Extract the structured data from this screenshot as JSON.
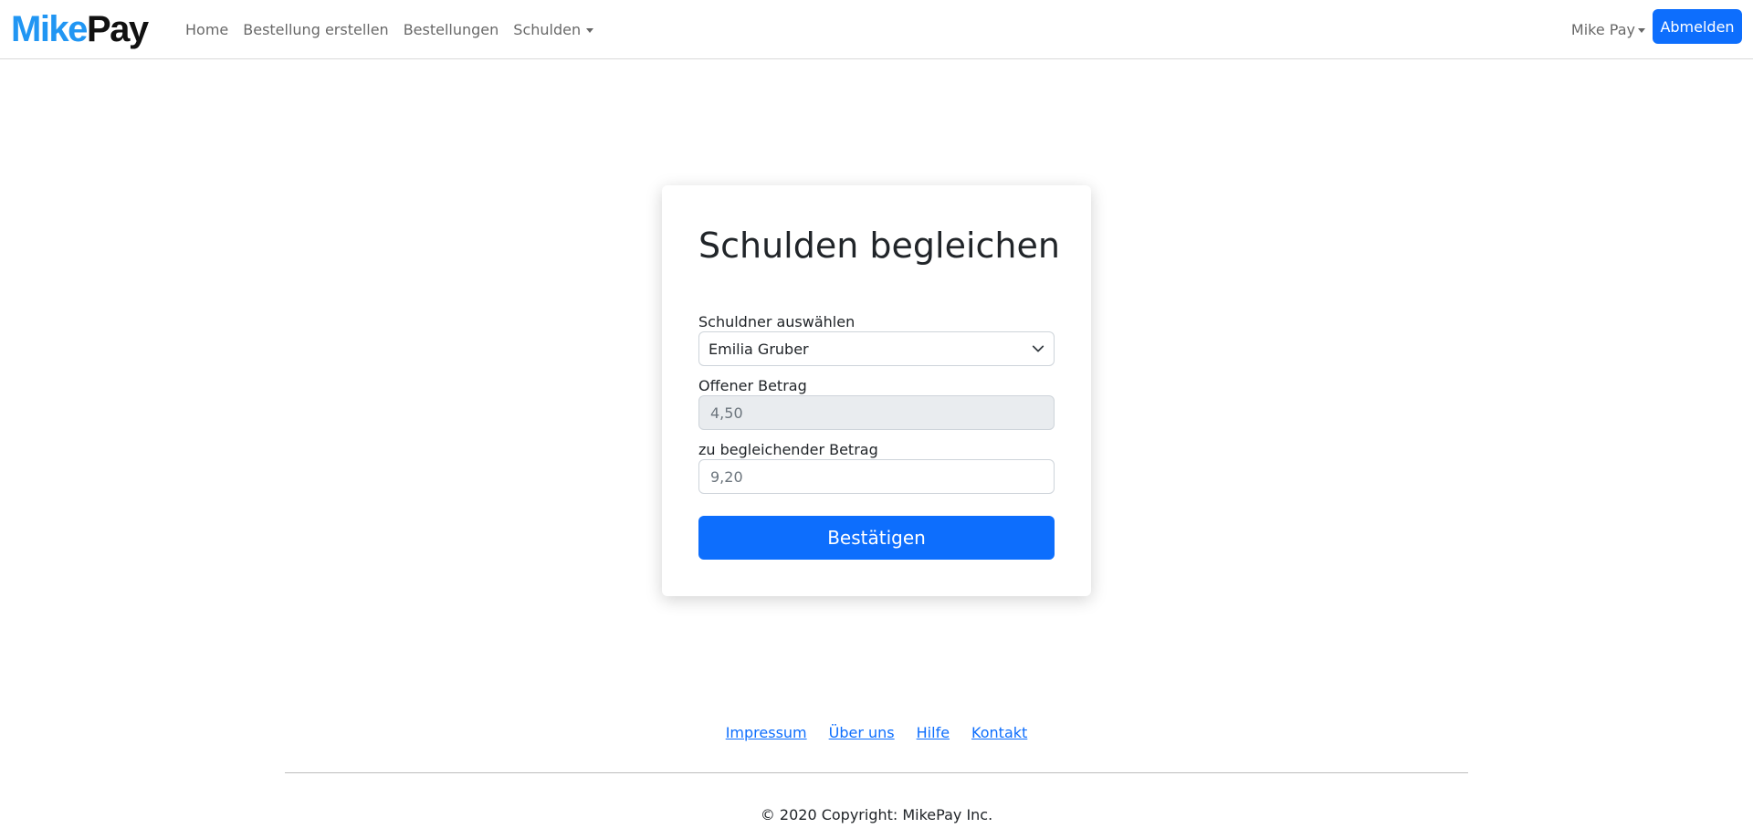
{
  "brand": {
    "part1": "Mike",
    "part2": "Pay"
  },
  "nav": {
    "home": "Home",
    "create_order": "Bestellung erstellen",
    "orders": "Bestellungen",
    "debts": "Schulden"
  },
  "user": {
    "name": "Mike Pay",
    "logout_label": "Abmelden"
  },
  "card": {
    "title": "Schulden begleichen",
    "debtor_label": "Schuldner auswählen",
    "debtor_value": "Emilia Gruber",
    "open_amount_label": "Offener Betrag",
    "open_amount_value": "4,50",
    "settle_amount_label": "zu begleichender Betrag",
    "settle_amount_value": "9,20",
    "confirm_label": "Bestätigen"
  },
  "footer": {
    "links": [
      "Impressum",
      "Über uns",
      "Hilfe",
      "Kontakt"
    ],
    "copyright": "© 2020 Copyright: MikePay Inc."
  },
  "colors": {
    "primary": "#0d6efd",
    "brand_blue": "#2196f3"
  },
  "icons": {
    "select_chevron": "chevron-down-icon",
    "dropdown_caret": "caret-down-icon"
  }
}
